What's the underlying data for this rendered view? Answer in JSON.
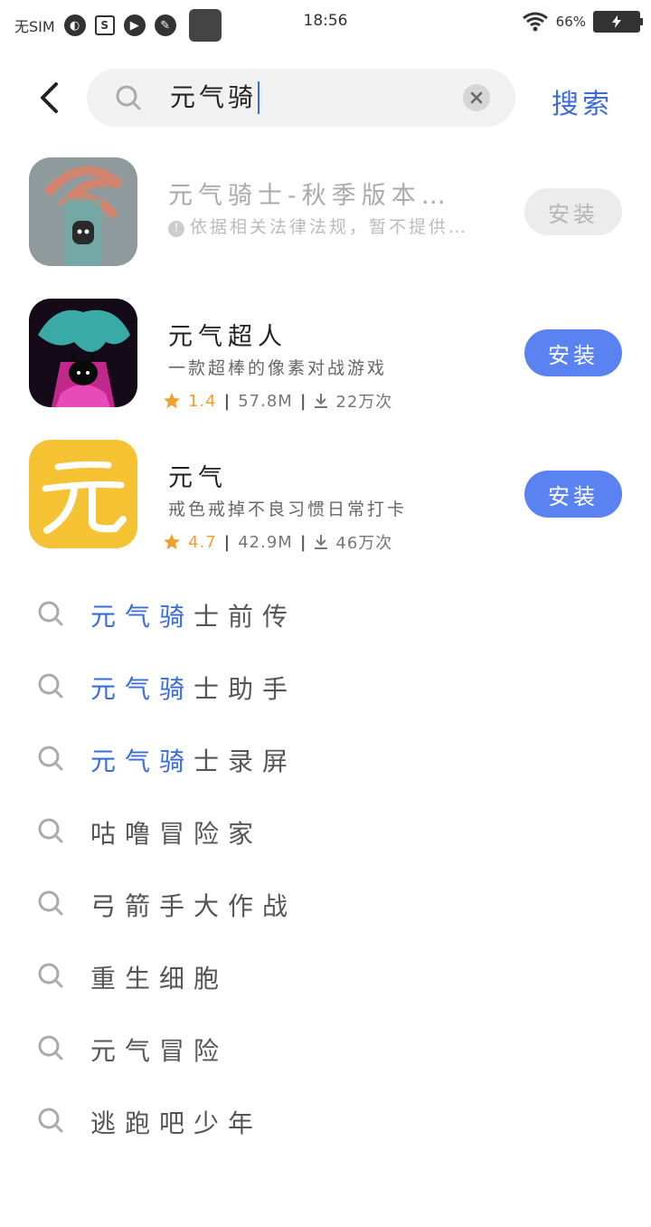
{
  "status_bar": {
    "carrier": "无SIM",
    "time": "18:56",
    "battery": "66%"
  },
  "header": {
    "query": "元气骑",
    "search_button": "搜索"
  },
  "results": [
    {
      "title": "元气骑士-秋季版本…",
      "notice": "依据相关法律法规，暂不提供…",
      "install": "安装",
      "state": "disabled"
    },
    {
      "title": "元气超人",
      "desc": "一款超棒的像素对战游戏",
      "rating": "1.4",
      "size": "57.8M",
      "downloads": "22万次",
      "install": "安装"
    },
    {
      "title": "元气",
      "desc": "戒色戒掉不良习惯日常打卡",
      "rating": "4.7",
      "size": "42.9M",
      "downloads": "46万次",
      "install": "安装"
    }
  ],
  "suggestions": [
    {
      "match": "元气骑",
      "rest": "士前传"
    },
    {
      "match": "元气骑",
      "rest": "士助手"
    },
    {
      "match": "元气骑",
      "rest": "士录屏"
    },
    {
      "match": "",
      "rest": "咕噜冒险家"
    },
    {
      "match": "",
      "rest": "弓箭手大作战"
    },
    {
      "match": "",
      "rest": "重生细胞"
    },
    {
      "match": "",
      "rest": "元气冒险"
    },
    {
      "match": "",
      "rest": "逃跑吧少年"
    }
  ],
  "colors": {
    "accent": "#5a82f0",
    "link": "#3a6bd8",
    "rating": "#f0a030"
  }
}
